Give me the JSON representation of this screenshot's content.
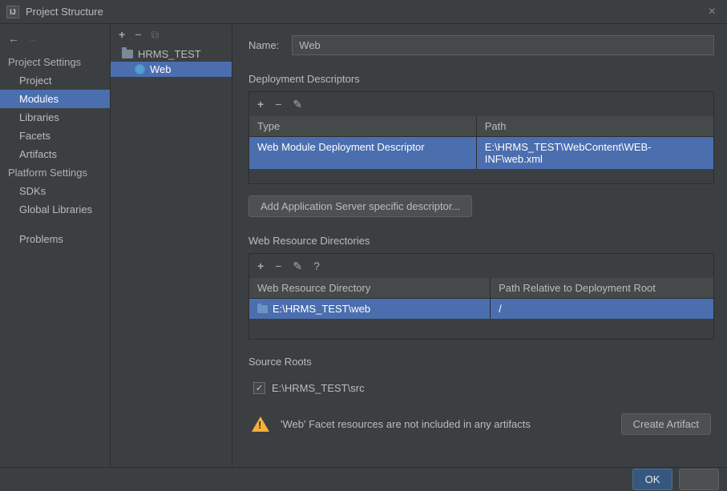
{
  "window": {
    "title": "Project Structure"
  },
  "leftNav": {
    "projectSettingsHeader": "Project Settings",
    "items": [
      "Project",
      "Modules",
      "Libraries",
      "Facets",
      "Artifacts"
    ],
    "selectedIndex": 1,
    "platformSettingsHeader": "Platform Settings",
    "platformItems": [
      "SDKs",
      "Global Libraries"
    ],
    "problems": "Problems"
  },
  "tree": {
    "module": "HRMS_TEST",
    "facet": "Web"
  },
  "content": {
    "nameLabel": "Name:",
    "nameValue": "Web",
    "deploymentDescriptors": {
      "title": "Deployment Descriptors",
      "columns": {
        "type": "Type",
        "path": "Path"
      },
      "row": {
        "type": "Web Module Deployment Descriptor",
        "path": "E:\\HRMS_TEST\\WebContent\\WEB-INF\\web.xml"
      },
      "addButton": "Add Application Server specific descriptor..."
    },
    "webResourceDirs": {
      "title": "Web Resource Directories",
      "columns": {
        "dir": "Web Resource Directory",
        "rel": "Path Relative to Deployment Root"
      },
      "row": {
        "dir": "E:\\HRMS_TEST\\web",
        "rel": "/"
      }
    },
    "sourceRoots": {
      "title": "Source Roots",
      "item": "E:\\HRMS_TEST\\src",
      "checked": true
    },
    "warning": {
      "msg": "'Web' Facet resources are not included in any artifacts",
      "button": "Create Artifact"
    }
  },
  "bottom": {
    "ok": "OK"
  }
}
